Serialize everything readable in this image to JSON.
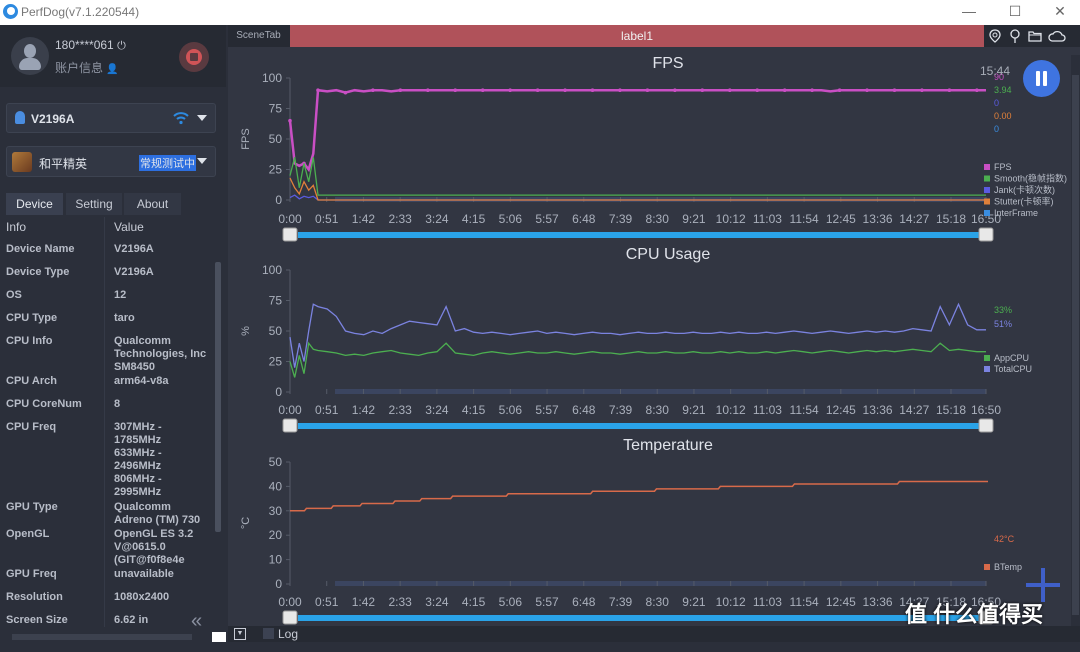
{
  "window": {
    "title": "PerfDog(v7.1.220544)",
    "minimize": "—",
    "maximize": "☐",
    "close": "✕"
  },
  "account": {
    "phone": "180****061",
    "info_label": "账户信息"
  },
  "device_select": {
    "value": "V2196A"
  },
  "app_select": {
    "name": "和平精英",
    "status": "常规测试中"
  },
  "tabs": [
    {
      "label": "Device"
    },
    {
      "label": "Setting"
    },
    {
      "label": "About"
    }
  ],
  "table": {
    "headers": [
      "Info",
      "Value"
    ],
    "rows": [
      {
        "key": "Device Name",
        "value": "V2196A"
      },
      {
        "key": "Device Type",
        "value": "V2196A"
      },
      {
        "key": "OS",
        "value": "12"
      },
      {
        "key": "CPU Type",
        "value": "taro"
      },
      {
        "key": "CPU Info",
        "value": "Qualcomm\nTechnologies, Inc\nSM8450"
      },
      {
        "key": "CPU Arch",
        "value": "arm64-v8a"
      },
      {
        "key": "CPU CoreNum",
        "value": "8"
      },
      {
        "key": "CPU Freq",
        "value": "307MHz -\n1785MHz\n633MHz -\n2496MHz\n806MHz -\n2995MHz"
      },
      {
        "key": "GPU Type",
        "value": "Qualcomm\nAdreno (TM) 730"
      },
      {
        "key": "OpenGL",
        "value": "OpenGL ES 3.2\nV@0615.0\n(GIT@f0f8e4e"
      },
      {
        "key": "GPU Freq",
        "value": "unavailable"
      },
      {
        "key": "Resolution",
        "value": "1080x2400"
      },
      {
        "key": "Screen Size",
        "value": "6.62 in"
      }
    ]
  },
  "scene": {
    "tab_label": "SceneTab",
    "label": "label1"
  },
  "toolbar_icons": [
    "location-icon",
    "pin-icon",
    "folder-icon",
    "cloud-icon"
  ],
  "clock": "15:44",
  "log_label": "Log",
  "watermark": "值 什么值得买",
  "colors": {
    "fps": "#c94fc4",
    "smooth": "#4caf50",
    "jank": "#5b5be0",
    "stutter": "#e0803a",
    "interframe": "#3a8de0",
    "appcpu": "#4caf50",
    "totalcpu": "#7b83e0",
    "btemp": "#d86a4a",
    "label_bar": "#b0525a",
    "slider": "#2aa3e8"
  },
  "chart_data": [
    {
      "type": "line",
      "title": "FPS",
      "ylabel": "FPS",
      "ylim": [
        0,
        100
      ],
      "yticks": [
        "0",
        "25",
        "50",
        "75",
        "100"
      ],
      "xticks": [
        "0:00",
        "0:51",
        "1:42",
        "2:33",
        "3:24",
        "4:15",
        "5:06",
        "5:57",
        "6:48",
        "7:39",
        "8:30",
        "9:21",
        "10:12",
        "11:03",
        "11:54",
        "12:45",
        "13:36",
        "14:27",
        "15:18",
        "16:50"
      ],
      "legend_values": [
        "90",
        "3.94",
        "0",
        "0.00",
        "0"
      ],
      "series": [
        {
          "name": "FPS",
          "key": "fps",
          "values": [
            65,
            30,
            28,
            30,
            25,
            38,
            90,
            89,
            90,
            88,
            90,
            89,
            90,
            90,
            89,
            90,
            90,
            90,
            90,
            90,
            90,
            90,
            90,
            90,
            90,
            90,
            90,
            90,
            90,
            90,
            90,
            90,
            90,
            90,
            90,
            90,
            90,
            90,
            90,
            90,
            90,
            90,
            90,
            90,
            90,
            90,
            90,
            90,
            90,
            90,
            90,
            90,
            90,
            90,
            90,
            90,
            90,
            90,
            90,
            90,
            90,
            90,
            89,
            90,
            90,
            90,
            90,
            90,
            90,
            90,
            90,
            90,
            90,
            90,
            90,
            90,
            90,
            90,
            90,
            90
          ]
        },
        {
          "name": "Smooth(稳帧指数)",
          "key": "smooth",
          "values": [
            20,
            35,
            10,
            30,
            15,
            35,
            4,
            4,
            4,
            4,
            4,
            4,
            4,
            4,
            4,
            4,
            4,
            4,
            4,
            4,
            4,
            4,
            4,
            4,
            4,
            4,
            4,
            4,
            4,
            4,
            4,
            4,
            4,
            4,
            4,
            4,
            4,
            4,
            4,
            4,
            4,
            4,
            4,
            4,
            4,
            4,
            4,
            4,
            4,
            4,
            4,
            4,
            4,
            4,
            4,
            4,
            4,
            4,
            4,
            4,
            4,
            4,
            4,
            4,
            4,
            4,
            4,
            4,
            4,
            4,
            4,
            4,
            4,
            4,
            4,
            4,
            4,
            4,
            4,
            4
          ]
        },
        {
          "name": "Jank(卡顿次数)",
          "key": "jank",
          "values": [
            2,
            4,
            1,
            3,
            2,
            3,
            0,
            0,
            0,
            0,
            0,
            0,
            0,
            0,
            0,
            0,
            0,
            0,
            0,
            0,
            0,
            0,
            0,
            0,
            0,
            0,
            0,
            0,
            0,
            0,
            0,
            0,
            0,
            0,
            0,
            0,
            0,
            0,
            0,
            0,
            0,
            0,
            0,
            0,
            0,
            0,
            0,
            0,
            0,
            0,
            0,
            0,
            0,
            0,
            0,
            0,
            0,
            0,
            0,
            0,
            0,
            0,
            0,
            0,
            0,
            0,
            0,
            0,
            0,
            0,
            0,
            0,
            0,
            0,
            0,
            0,
            0,
            0,
            0,
            0
          ]
        },
        {
          "name": "Stutter(卡顿率)",
          "key": "stutter",
          "values": [
            18,
            10,
            5,
            15,
            8,
            12,
            0,
            0,
            0,
            0,
            0,
            0,
            0,
            0,
            0,
            0,
            0,
            0,
            0,
            0,
            0,
            0,
            0,
            0,
            0,
            0,
            0,
            0,
            0,
            0,
            0,
            0,
            0,
            0,
            0,
            0,
            0,
            0,
            0,
            0,
            0,
            0,
            0,
            0,
            0,
            0,
            0,
            0,
            0,
            0,
            0,
            0,
            0,
            0,
            0,
            0,
            0,
            0,
            0,
            0,
            0,
            0,
            0,
            0,
            0,
            0,
            0,
            0,
            0,
            0,
            0,
            0,
            0,
            0,
            0,
            0,
            0,
            0,
            0,
            0
          ]
        },
        {
          "name": "InterFrame",
          "key": "interframe",
          "values": []
        }
      ]
    },
    {
      "type": "line",
      "title": "CPU Usage",
      "ylabel": "%",
      "ylim": [
        0,
        100
      ],
      "yticks": [
        "0",
        "25",
        "50",
        "75",
        "100"
      ],
      "xticks": [
        "0:00",
        "0:51",
        "1:42",
        "2:33",
        "3:24",
        "4:15",
        "5:06",
        "5:57",
        "6:48",
        "7:39",
        "8:30",
        "9:21",
        "10:12",
        "11:03",
        "11:54",
        "12:45",
        "13:36",
        "14:27",
        "15:18",
        "16:50"
      ],
      "legend_values": [
        "33%",
        "51%"
      ],
      "series": [
        {
          "name": "AppCPU",
          "key": "appcpu",
          "values": [
            25,
            12,
            30,
            15,
            40,
            35,
            34,
            33,
            32,
            30,
            31,
            30,
            32,
            33,
            34,
            32,
            31,
            30,
            32,
            33,
            40,
            32,
            31,
            30,
            32,
            33,
            32,
            31,
            32,
            33,
            32,
            32,
            33,
            32,
            31,
            32,
            33,
            32,
            32,
            31,
            32,
            33,
            32,
            32,
            33,
            32,
            32,
            33,
            32,
            32,
            33,
            32,
            33,
            32,
            32,
            33,
            32,
            33,
            34,
            33,
            32,
            33,
            34,
            33,
            32,
            33,
            34,
            33,
            34,
            33,
            34,
            35,
            34,
            33,
            40,
            34,
            35,
            34,
            33,
            33
          ]
        },
        {
          "name": "TotalCPU",
          "key": "totalcpu",
          "values": [
            45,
            20,
            40,
            25,
            50,
            72,
            70,
            68,
            62,
            50,
            48,
            47,
            50,
            48,
            52,
            55,
            58,
            57,
            56,
            55,
            70,
            50,
            52,
            49,
            48,
            49,
            48,
            47,
            48,
            49,
            50,
            48,
            49,
            48,
            47,
            48,
            49,
            48,
            48,
            47,
            48,
            49,
            48,
            48,
            49,
            48,
            48,
            49,
            48,
            48,
            49,
            48,
            49,
            48,
            48,
            49,
            48,
            49,
            50,
            49,
            48,
            49,
            50,
            49,
            48,
            49,
            50,
            49,
            50,
            49,
            50,
            52,
            51,
            50,
            70,
            55,
            72,
            55,
            51,
            51
          ]
        }
      ]
    },
    {
      "type": "line",
      "title": "Temperature",
      "ylabel": "°C",
      "ylim": [
        0,
        50
      ],
      "yticks": [
        "0",
        "10",
        "20",
        "30",
        "40",
        "50"
      ],
      "xticks": [
        "0:00",
        "0:51",
        "1:42",
        "2:33",
        "3:24",
        "4:15",
        "5:06",
        "5:57",
        "6:48",
        "7:39",
        "8:30",
        "9:21",
        "10:12",
        "11:03",
        "11:54",
        "12:45",
        "13:36",
        "14:27",
        "15:18",
        "16:50"
      ],
      "legend_values": [
        "42°C"
      ],
      "series": [
        {
          "name": "BTemp",
          "key": "btemp",
          "steps": [
            [
              0,
              30
            ],
            [
              0.7,
              31
            ],
            [
              2.0,
              32
            ],
            [
              3.4,
              33
            ],
            [
              5.0,
              34
            ],
            [
              6.3,
              35
            ],
            [
              7.8,
              36
            ],
            [
              10.5,
              37
            ],
            [
              14.6,
              38
            ],
            [
              17.7,
              39
            ],
            [
              20.8,
              40
            ],
            [
              24.4,
              41
            ],
            [
              29.5,
              42
            ],
            [
              33.8,
              42
            ]
          ]
        }
      ]
    }
  ]
}
